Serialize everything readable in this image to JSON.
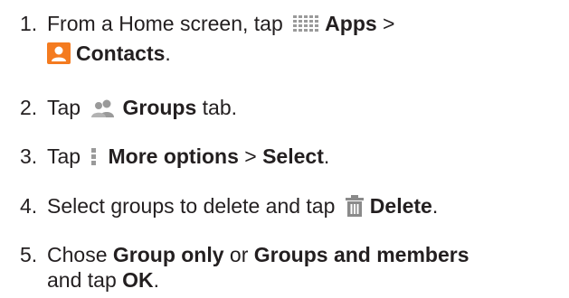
{
  "steps": [
    {
      "number": "1.",
      "t1": "From a Home screen, tap ",
      "apps_label": "Apps",
      "t2": " >",
      "contacts_label": "Contacts",
      "t3": "."
    },
    {
      "number": "2.",
      "t1": "Tap ",
      "groups_label": "Groups",
      "t2": " tab."
    },
    {
      "number": "3.",
      "t1": "Tap ",
      "more_label": "More options",
      "t2": " > ",
      "select_label": "Select",
      "t3": "."
    },
    {
      "number": "4.",
      "t1": "Select groups to delete and tap ",
      "delete_label": "Delete",
      "t2": "."
    },
    {
      "number": "5.",
      "t1": "Chose ",
      "group_only_label": "Group only",
      "t2": " or ",
      "groups_members_label": "Groups and members",
      "t3": "and tap ",
      "ok_label": "OK",
      "t4": "."
    }
  ],
  "icons": {
    "apps": "apps-grid-icon",
    "contacts": "contacts-icon",
    "groups": "groups-icon",
    "more_options": "more-options-icon",
    "delete": "trash-icon"
  },
  "colors": {
    "text": "#231f20",
    "contacts_icon": "#f47b20",
    "icon_gray": "#9a9a9a",
    "trash_icon": "#8a8a8a"
  }
}
